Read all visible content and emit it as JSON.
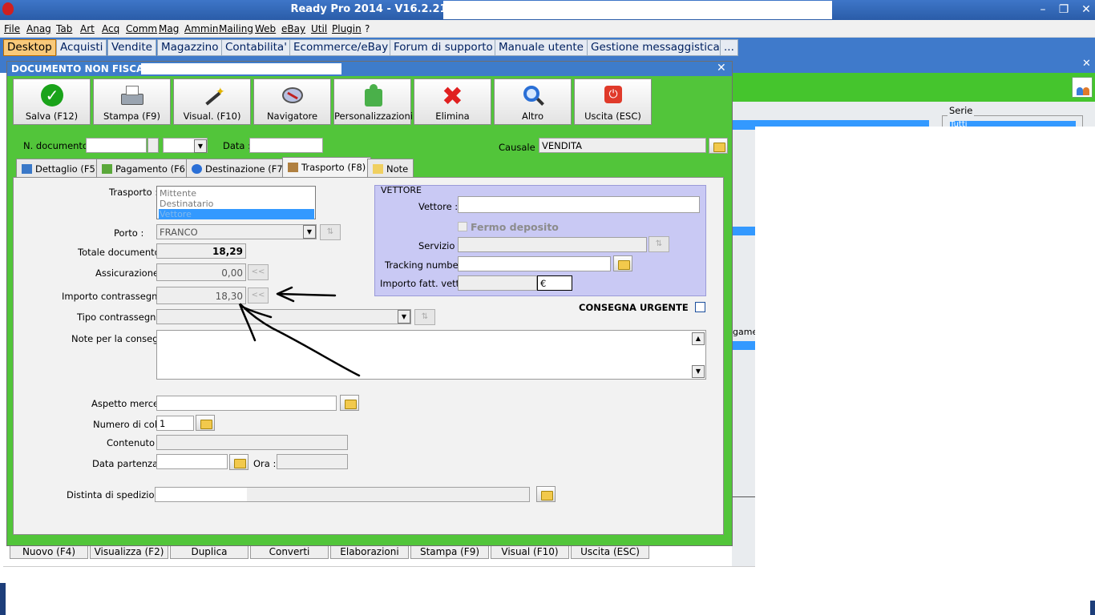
{
  "app": {
    "title": "Ready Pro 2014 - V16.2.21"
  },
  "menu": [
    "File",
    "Anag",
    "Tab",
    "Art",
    "Acq",
    "Comm",
    "Mag",
    "Ammin",
    "Mailing",
    "Web",
    "eBay",
    "Util",
    "Plugin",
    "?"
  ],
  "desktop_tabs": [
    "Desktop",
    "Acquisti",
    "Vendite",
    "Magazzino",
    "Contabilita'",
    "Ecommerce/eBay",
    "Forum di supporto",
    "Manuale utente",
    "Gestione messaggistica",
    "..."
  ],
  "dialog": {
    "title": "DOCUMENTO NON FISCALE",
    "toolbar": [
      "Salva (F12)",
      "Stampa (F9)",
      "Visual. (F10)",
      "Navigatore",
      "Personalizzazioni",
      "Elimina",
      "Altro",
      "Uscita (ESC)"
    ],
    "header": {
      "n_documento_label": "N. documento :",
      "data_label": "Data :",
      "causale_label": "Causale :",
      "causale_value": "VENDITA"
    },
    "tabs": [
      "Dettaglio (F5)",
      "Pagamento (F6)",
      "Destinazione (F7)",
      "Trasporto (F8)",
      "Note"
    ],
    "trasporto": {
      "trasporto_label": "Trasporto :",
      "trasporto_options": [
        "Mittente",
        "Destinatario",
        "Vettore"
      ],
      "porto_label": "Porto :",
      "porto_value": "FRANCO",
      "totale_label": "Totale documento :",
      "totale_value": "18,29",
      "assicurazione_label": "Assicurazione :",
      "assicurazione_value": "0,00",
      "contrassegno_label": "Importo contrassegno :",
      "contrassegno_value": "18,30",
      "tipo_contrassegno_label": "Tipo contrassegno :",
      "note_consegna_label": "Note per la consegna",
      "aspetto_label": "Aspetto merce :",
      "colli_label": "Numero di colli :",
      "colli_value": "1",
      "contenuto_label": "Contenuto :",
      "data_partenza_label": "Data partenza :",
      "ora_label": "Ora :",
      "distinta_label": "Distinta di spedizione :",
      "copy_btn": "<<"
    },
    "vettore": {
      "title": "VETTORE",
      "vettore_label": "Vettore :",
      "fermo_label": "Fermo deposito",
      "servizio_label": "Servizio :",
      "tracking_label": "Tracking number :",
      "importo_label": "Importo fatt. vett.",
      "currency": "€",
      "urgente_label": "CONSEGNA URGENTE"
    }
  },
  "bottom_buttons": [
    "Nuovo (F4)",
    "Visualizza (F2)",
    "Duplica",
    "Converti",
    "Elaborazioni",
    "Stampa (F9)",
    "Visual (F10)",
    "Uscita (ESC)"
  ],
  "background": {
    "serie_label": "Serie",
    "serie_value": "Tutti",
    "partial_label": "gamen"
  }
}
